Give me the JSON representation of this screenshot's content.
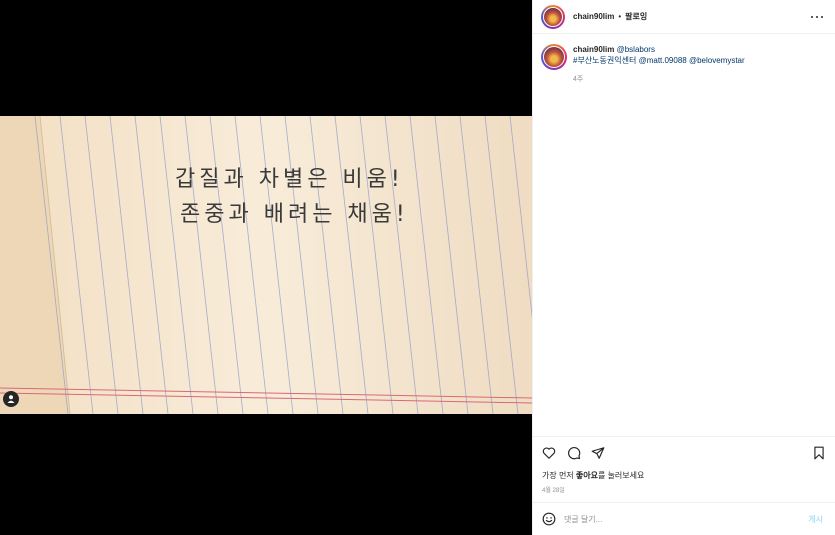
{
  "post": {
    "username": "chain90lim",
    "dot": "•",
    "follow_label": "팔로잉",
    "caption_mention_user": "@bslabors",
    "caption_hashtag": "#부산노동권익센터",
    "caption_mention_1": "@matt.09088",
    "caption_mention_2": "@belovemystar",
    "time_ago": "4주"
  },
  "media": {
    "handwriting_line_1": "갑질과 차별은 비움!",
    "handwriting_line_2": "존중과 배려는 채움!"
  },
  "engagement": {
    "like_prefix": "가장 먼저 ",
    "like_bold": "좋아요",
    "like_suffix": "를 눌러보세요",
    "date": "4월 28일"
  },
  "comment": {
    "placeholder": "댓글 달기...",
    "post_label": "게시"
  },
  "colors": {
    "paper": "#f7e9d4",
    "rule_line": "#8c98c8",
    "margin_line": "#d9687a",
    "link": "#00376b",
    "post_disabled": "#b2dffc"
  },
  "icons": [
    "heart-icon",
    "comment-icon",
    "share-icon",
    "bookmark-icon",
    "more-icon",
    "emoji-icon",
    "user-tag-icon"
  ]
}
